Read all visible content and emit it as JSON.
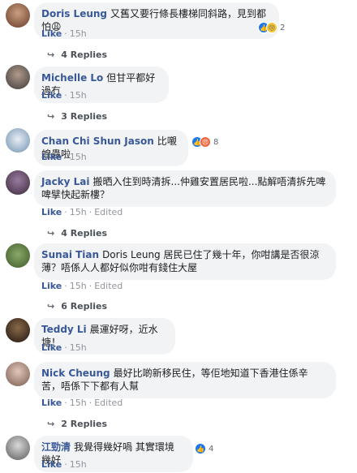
{
  "like_label": "Like",
  "edited_label": "Edited",
  "comments": [
    {
      "author": "Doris Leung",
      "text": "又舊又要行條長樓梯同斜路，見到都怕😩",
      "time": "15h",
      "reactions": "2",
      "replies": "4 Replies"
    },
    {
      "author": "Michelle Lo",
      "text": "但甘平都好過冇",
      "time": "15h",
      "replies": "3 Replies"
    },
    {
      "author": "Chan Chi Shun Jason",
      "text": "比嚫蝗蟲啦",
      "time": "15h",
      "reactions": "8"
    },
    {
      "author": "Jacky Lai",
      "text": "搬晒入住到時清拆...仲雞安置居民啦...點解唔清拆先啤啤擘快起新樓？",
      "time": "15h",
      "replies": "4 Replies"
    },
    {
      "author": "Sunai Tian",
      "text": "Doris Leung 居民已住了幾十年，你咁講是否很涼薄？唔係人人都好似你咁有錢住大屋",
      "time": "15h",
      "replies": "6 Replies"
    },
    {
      "author": "Teddy Li",
      "text": "晨運好呀，近水塘！",
      "time": "15h"
    },
    {
      "author": "Nick Cheung",
      "text": "最好比啲新移民住，等佢地知道下香港住係辛苦，唔係下下都有人幫",
      "time": "15h",
      "replies": "2 Replies"
    },
    {
      "author": "江勁清",
      "text": "我覺得幾好喎 其實環境幾好",
      "time": "15h",
      "reactions": "4"
    }
  ],
  "colors": {
    "author": "#385898",
    "bubble": "#f2f3f5",
    "meta": "#90949c"
  }
}
